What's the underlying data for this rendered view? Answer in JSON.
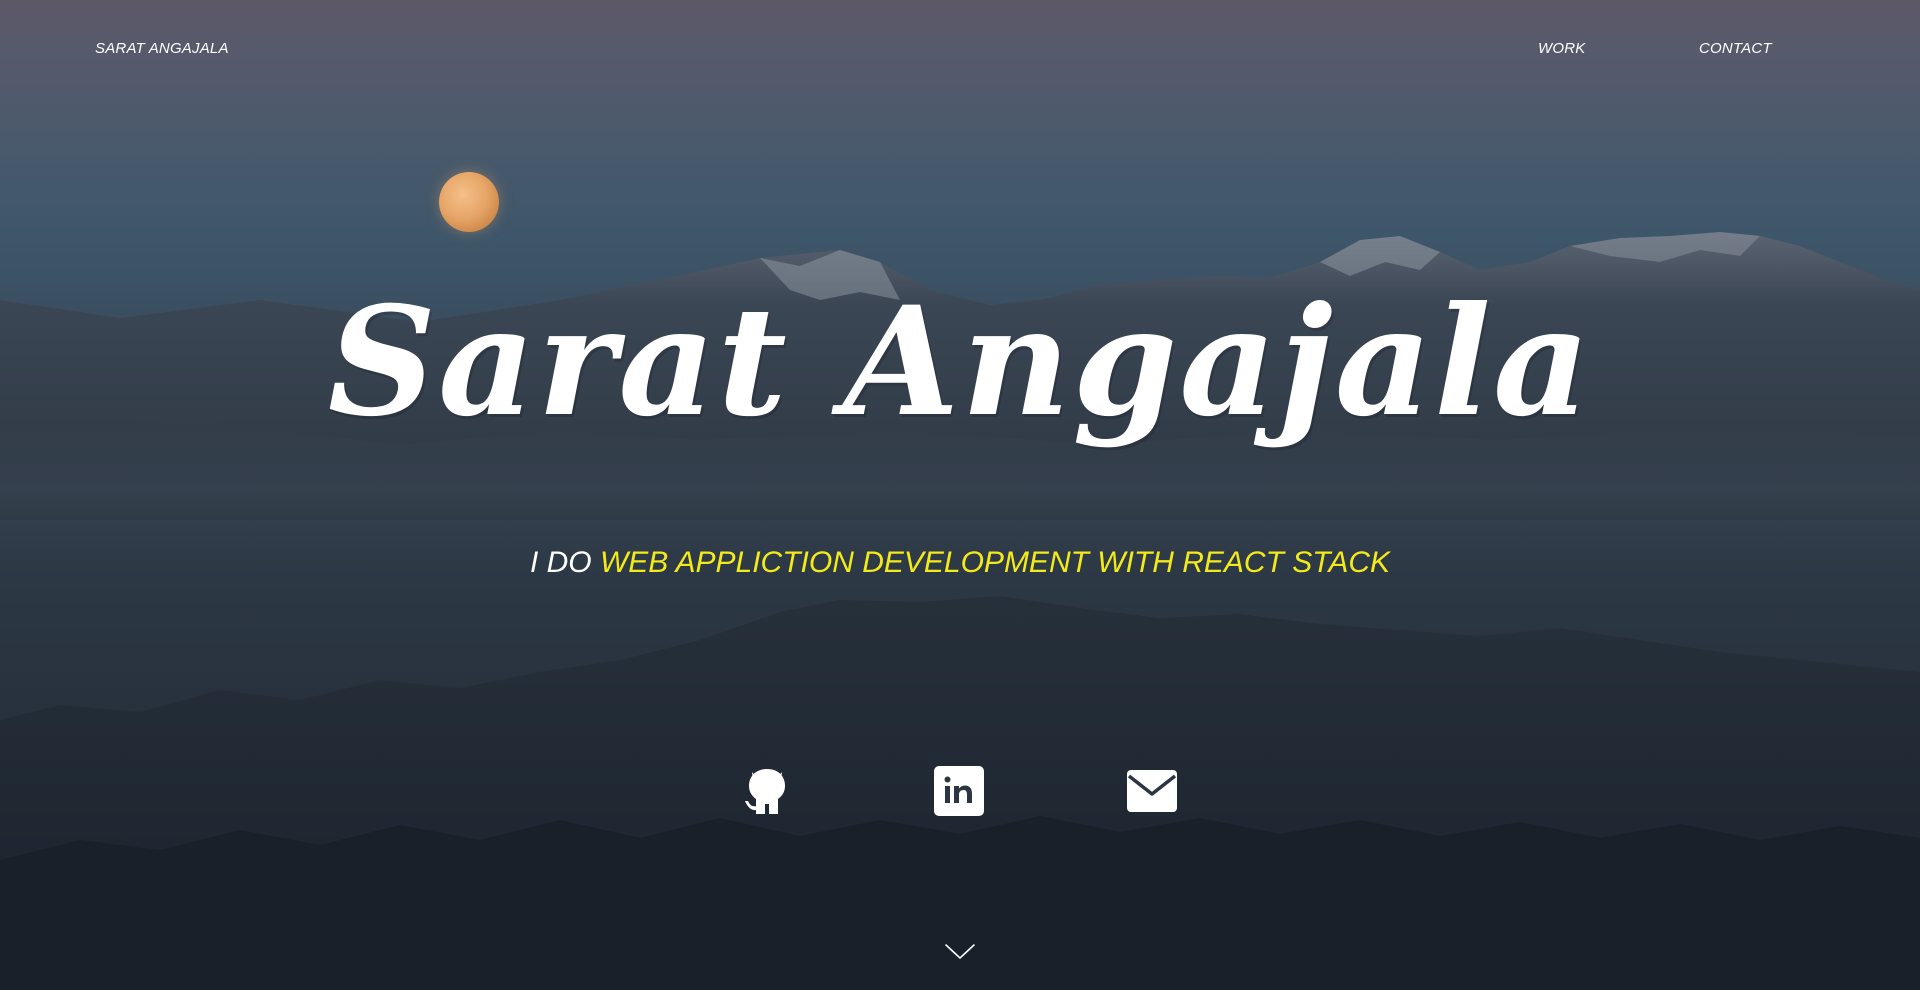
{
  "nav": {
    "brand": "SARAT ANGAJALA",
    "links": [
      {
        "label": "WORK"
      },
      {
        "label": "CONTACT"
      }
    ]
  },
  "hero": {
    "title": "Sarat Angajala",
    "tagline_prefix": "I DO",
    "tagline_highlight": "WEB APPLICTION DEVELOPMENT WITH REACT STACK"
  },
  "social": [
    {
      "icon": "github-icon"
    },
    {
      "icon": "linkedin-icon"
    },
    {
      "icon": "mail-icon"
    }
  ],
  "scroll": {
    "icon": "chevron-down-icon"
  },
  "colors": {
    "accent": "#f3ea19",
    "text": "#ffffff",
    "moon": "#e7a567"
  }
}
